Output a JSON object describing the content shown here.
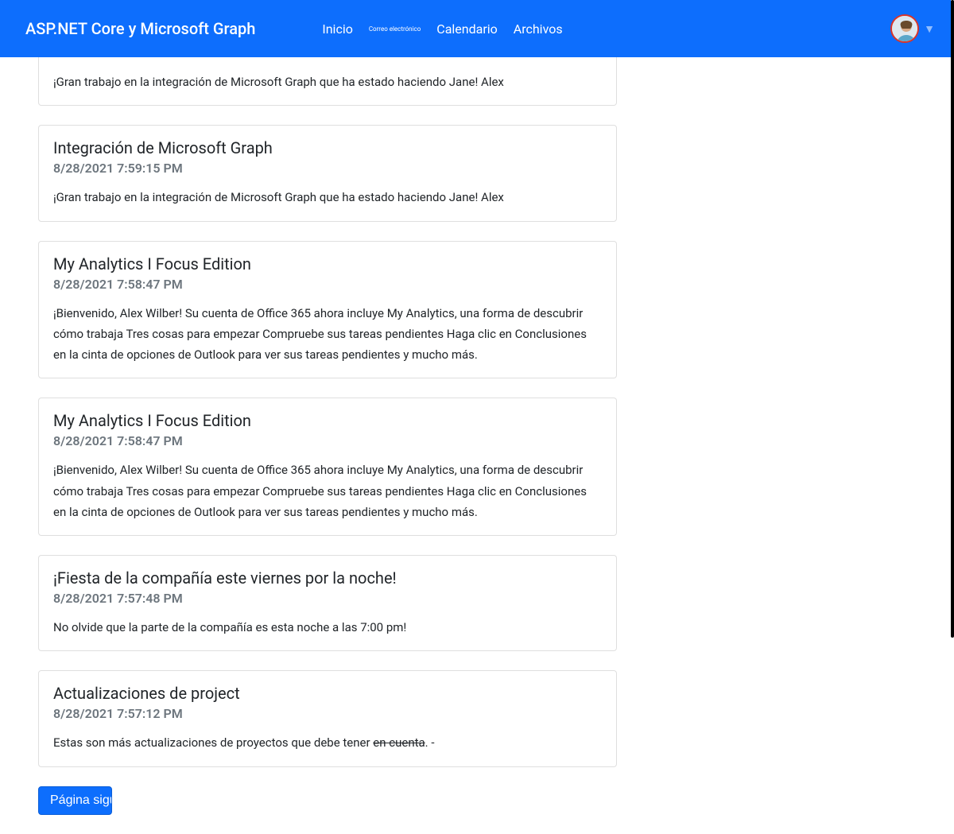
{
  "navbar": {
    "brand": "ASP.NET Core y Microsoft Graph",
    "links": {
      "home": "Inicio",
      "mail": "Correo electrónico",
      "calendar": "Calendario",
      "files": "Archivos"
    }
  },
  "emails": [
    {
      "subject": "",
      "datetime": "",
      "body": "¡Gran trabajo en la integración de Microsoft Graph que ha estado haciendo Jane! Alex"
    },
    {
      "subject": "Integración de Microsoft Graph",
      "datetime": "8/28/2021 7:59:15 PM",
      "body": "¡Gran trabajo en la integración de Microsoft Graph que ha estado haciendo Jane! Alex"
    },
    {
      "subject": "My Analytics I Focus Edition",
      "datetime": "8/28/2021 7:58:47 PM",
      "body": "¡Bienvenido, Alex Wilber! Su cuenta de Office 365 ahora incluye My Analytics, una forma de descubrir cómo trabaja Tres cosas para empezar Compruebe sus tareas pendientes Haga clic en Conclusiones en la cinta de opciones de Outlook para ver sus tareas pendientes y mucho más."
    },
    {
      "subject": "My Analytics I Focus Edition",
      "datetime": "8/28/2021 7:58:47 PM",
      "body": "¡Bienvenido, Alex Wilber! Su cuenta de Office 365 ahora incluye My Analytics, una forma de descubrir cómo trabaja Tres cosas para empezar Compruebe sus tareas pendientes Haga clic en Conclusiones en la cinta de opciones de Outlook para ver sus tareas pendientes y mucho más."
    },
    {
      "subject": "¡Fiesta de la compañía este viernes por la noche!",
      "datetime": "8/28/2021 7:57:48 PM",
      "body": "No olvide que la parte de la compañía es esta noche a las 7:00 pm!"
    },
    {
      "subject": "Actualizaciones de project",
      "datetime": "8/28/2021 7:57:12 PM",
      "body_pre": "Estas son más actualizaciones de proyectos que debe tener ",
      "body_strike": "en cuenta",
      "body_post": ". -"
    }
  ],
  "pagination": {
    "next": "Página siguiente"
  }
}
